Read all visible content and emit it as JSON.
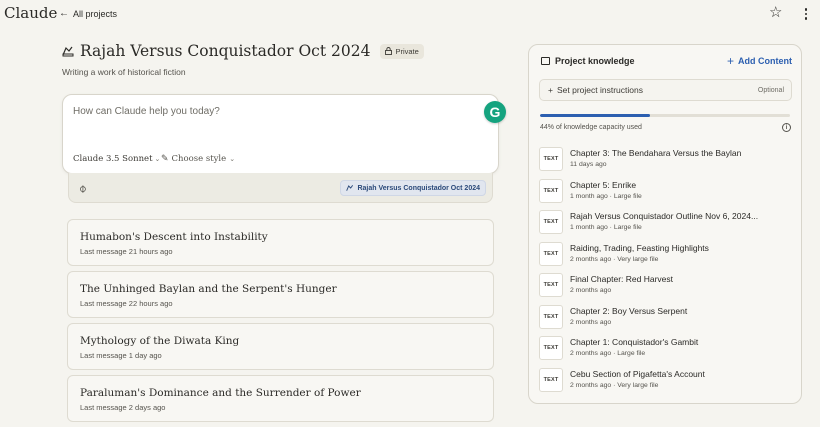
{
  "app": {
    "logo": "Claude"
  },
  "nav": {
    "back_label": "All projects"
  },
  "project": {
    "title": "Rajah Versus Conquistador Oct 2024",
    "visibility": "Private",
    "description": "Writing a work of historical fiction"
  },
  "composer": {
    "placeholder": "How can Claude help you today?",
    "model": "Claude 3.5 Sonnet",
    "style": "Choose style",
    "project_chip": "Rajah Versus Conquistador Oct 2024",
    "grammarly_letter": "G"
  },
  "chats": [
    {
      "title": "Humabon's Descent into Instability",
      "meta": "Last message 21 hours ago"
    },
    {
      "title": "The Unhinged Baylan and the Serpent's Hunger",
      "meta": "Last message 22 hours ago"
    },
    {
      "title": "Mythology of the Diwata King",
      "meta": "Last message 1 day ago"
    },
    {
      "title": "Paraluman's Dominance and the Surrender of Power",
      "meta": "Last message 2 days ago"
    }
  ],
  "knowledge": {
    "header": "Project knowledge",
    "add_label": "Add Content",
    "instructions_label": "Set project instructions",
    "instructions_optional": "Optional",
    "capacity_percent": 44,
    "capacity_label": "44% of knowledge capacity used",
    "files": [
      {
        "badge": "TEXT",
        "name": "Chapter 3: The Bendahara Versus the Baylan",
        "meta": "11 days ago"
      },
      {
        "badge": "TEXT",
        "name": "Chapter 5: Enrike",
        "meta": "1 month ago · Large file"
      },
      {
        "badge": "TEXT",
        "name": "Rajah Versus Conquistador Outline Nov 6, 2024...",
        "meta": "1 month ago · Large file"
      },
      {
        "badge": "TEXT",
        "name": "Raiding, Trading, Feasting Highlights",
        "meta": "2 months ago · Very large file"
      },
      {
        "badge": "TEXT",
        "name": "Final Chapter: Red Harvest",
        "meta": "2 months ago"
      },
      {
        "badge": "TEXT",
        "name": "Chapter 2: Boy Versus Serpent",
        "meta": "2 months ago"
      },
      {
        "badge": "TEXT",
        "name": "Chapter 1: Conquistador's Gambit",
        "meta": "2 months ago · Large file"
      },
      {
        "badge": "TEXT",
        "name": "Cebu Section of Pigafetta's Account",
        "meta": "2 months ago · Very large file"
      }
    ]
  },
  "colors": {
    "accent": "#2c5fb0",
    "background": "#f5f4ef",
    "grammarly": "#15a37f"
  },
  "icons": [
    "arrow-left-icon",
    "star-icon",
    "more-vertical-icon",
    "project-icon",
    "lock-icon",
    "paperclip-icon",
    "book-icon",
    "plus-icon",
    "info-icon",
    "palette-icon"
  ]
}
